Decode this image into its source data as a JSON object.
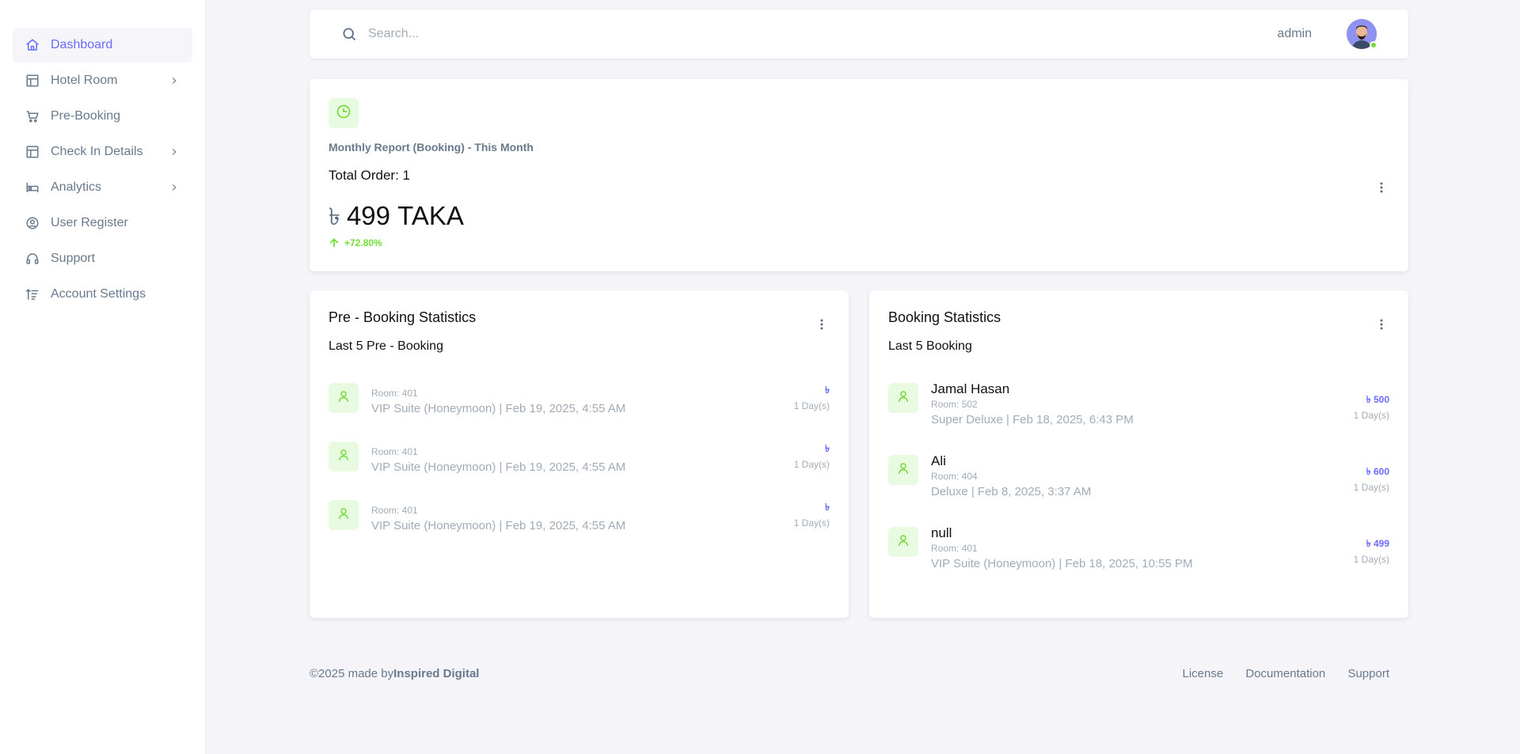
{
  "sidebar": {
    "items": [
      {
        "label": "Dashboard",
        "icon": "home-icon",
        "has_chevron": false,
        "active": true
      },
      {
        "label": "Hotel Room",
        "icon": "layout-icon",
        "has_chevron": true,
        "active": false
      },
      {
        "label": "Pre-Booking",
        "icon": "cart-icon",
        "has_chevron": false,
        "active": false
      },
      {
        "label": "Check In Details",
        "icon": "layout-icon",
        "has_chevron": true,
        "active": false
      },
      {
        "label": "Analytics",
        "icon": "bed-icon",
        "has_chevron": true,
        "active": false
      },
      {
        "label": "User Register",
        "icon": "user-circle-icon",
        "has_chevron": false,
        "active": false
      },
      {
        "label": "Support",
        "icon": "headset-icon",
        "has_chevron": false,
        "active": false
      },
      {
        "label": "Account Settings",
        "icon": "sort-settings-icon",
        "has_chevron": false,
        "active": false
      }
    ]
  },
  "navbar": {
    "search_placeholder": "Search...",
    "user_name": "admin",
    "status_color": "#71dd37"
  },
  "report": {
    "title": "Monthly Report (Booking) - This Month",
    "total_order": "Total Order: 1",
    "currency_symbol": "৳",
    "amount": "499 TAKA",
    "growth": "+72.80%"
  },
  "pre_booking": {
    "title": "Pre - Booking Statistics",
    "subtitle": "Last 5 Pre - Booking",
    "rows": [
      {
        "room": "Room: 401",
        "detail": "VIP Suite (Honeymoon) | Feb 19, 2025, 4:55 AM",
        "price": "৳",
        "days": "1 Day(s)"
      },
      {
        "room": "Room: 401",
        "detail": "VIP Suite (Honeymoon) | Feb 19, 2025, 4:55 AM",
        "price": "৳",
        "days": "1 Day(s)"
      },
      {
        "room": "Room: 401",
        "detail": "VIP Suite (Honeymoon) | Feb 19, 2025, 4:55 AM",
        "price": "৳",
        "days": "1 Day(s)"
      }
    ]
  },
  "booking": {
    "title": "Booking Statistics",
    "subtitle": "Last 5 Booking",
    "rows": [
      {
        "name": "Jamal Hasan",
        "room": "Room: 502",
        "detail": "Super Deluxe | Feb 18, 2025, 6:43 PM",
        "price": "৳ 500",
        "days": "1 Day(s)"
      },
      {
        "name": "Ali",
        "room": "Room: 404",
        "detail": "Deluxe | Feb 8, 2025, 3:37 AM",
        "price": "৳ 600",
        "days": "1 Day(s)"
      },
      {
        "name": "null",
        "room": "Room: 401",
        "detail": "VIP Suite (Honeymoon) | Feb 18, 2025, 10:55 PM",
        "price": "৳ 499",
        "days": "1 Day(s)"
      }
    ]
  },
  "footer": {
    "copyright": "©2025 made by",
    "brand": "Inspired Digital",
    "links": [
      "License",
      "Documentation",
      "Support"
    ]
  },
  "colors": {
    "accent": "#696cff",
    "success": "#71dd37",
    "icon_bg": "#e8fadf"
  }
}
